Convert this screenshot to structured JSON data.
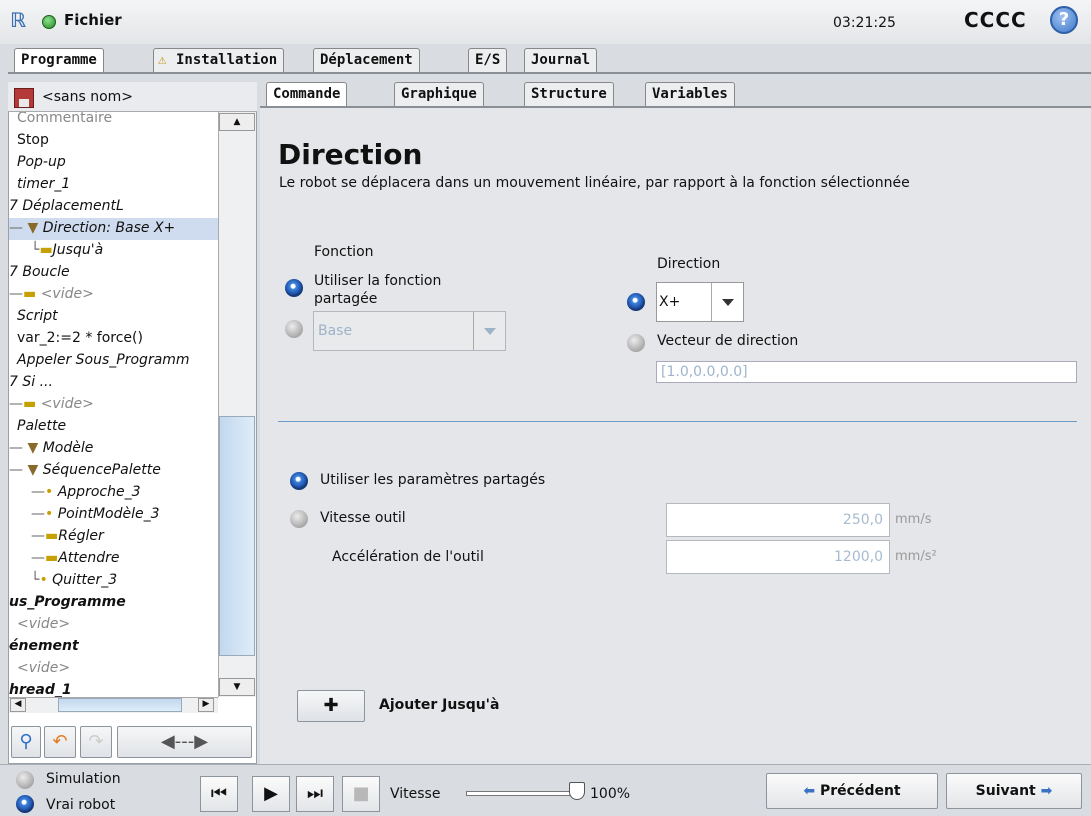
{
  "header": {
    "file_menu": "Fichier",
    "time": "03:21:25",
    "robot_name": "CCCC",
    "help_icon": "question-icon"
  },
  "main_tabs": [
    "Programme",
    "Installation",
    "Déplacement",
    "E/S",
    "Journal"
  ],
  "sub_tabs": [
    "Commande",
    "Graphique",
    "Structure",
    "Variables"
  ],
  "program": {
    "name": "<sans nom>"
  },
  "tree": [
    "Commentaire",
    "Stop",
    "Pop-up",
    "timer_1",
    "DéplacementL",
    "Direction: Base X+",
    "Jusqu'à",
    "Boucle",
    "<vide>",
    "Script",
    "var_2:=2 * force()",
    "Appeler Sous_Programm",
    "Si ...",
    "<vide>",
    "Palette",
    "Modèle",
    "SéquencePalette",
    "Approche_3",
    "PointModèle_3",
    "Régler",
    "Attendre",
    "Quitter_3",
    "us_Programme",
    "<vide>",
    "énement",
    "<vide>",
    "hread_1"
  ],
  "command": {
    "title": "Direction",
    "description": "Le robot se déplacera dans un mouvement linéaire, par rapport à la fonction sélectionnée",
    "function_label": "Fonction",
    "use_shared_function_line1": "Utiliser la fonction",
    "use_shared_function_line2": "partagée",
    "feature_value": "Base",
    "direction_label": "Direction",
    "direction_value": "X+",
    "direction_vector_label": "Vecteur de direction",
    "direction_vector_value": "[1.0,0.0,0.0]",
    "use_shared_params": "Utiliser les paramètres partagés",
    "tool_speed_label": "Vitesse outil",
    "tool_speed_value": "250,0",
    "tool_speed_unit": "mm/s",
    "tool_accel_label": "Accélération de l'outil",
    "tool_accel_value": "1200,0",
    "tool_accel_unit": "mm/s²",
    "add_until_label": "Ajouter Jusqu'à"
  },
  "footer": {
    "simulation": "Simulation",
    "real_robot": "Vrai robot",
    "speed_label": "Vitesse",
    "speed_value": "100%",
    "speed_fraction": 1.0,
    "previous": "Précédent",
    "next": "Suivant"
  }
}
